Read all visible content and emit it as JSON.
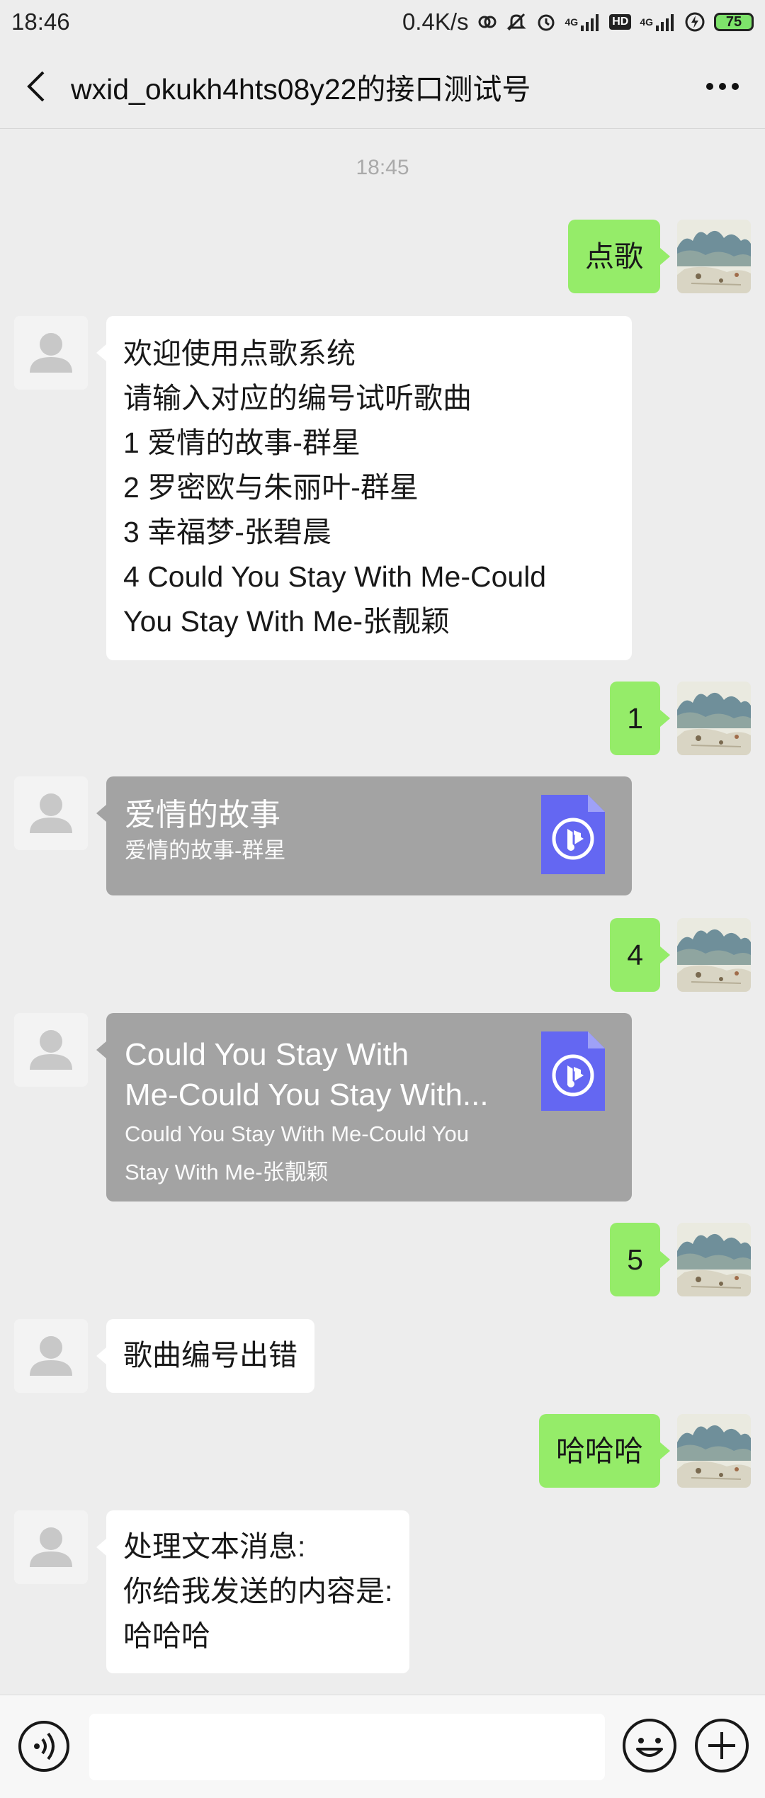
{
  "status_bar": {
    "time": "18:46",
    "speed": "0.4K/s",
    "network1": "4G",
    "hd": "HD",
    "network2": "4G",
    "battery": "75"
  },
  "header": {
    "title": "wxid_okukh4hts08y22的接口测试号"
  },
  "timestamp": "18:45",
  "messages": {
    "m1": {
      "text": "点歌"
    },
    "m2": {
      "lines": [
        "欢迎使用点歌系统",
        "请输入对应的编号试听歌曲",
        "1 爱情的故事-群星",
        "2 罗密欧与朱丽叶-群星",
        "3 幸福梦-张碧晨",
        "4 Could You Stay With Me-Could",
        "You Stay With Me-张靓颖"
      ]
    },
    "m3": {
      "text": "1"
    },
    "m4": {
      "title": "爱情的故事",
      "subtitle": "爱情的故事-群星",
      "icon": "music-file-icon"
    },
    "m5": {
      "text": "4"
    },
    "m6": {
      "title_lines": [
        "Could You Stay With",
        "Me-Could You Stay With..."
      ],
      "sub_lines": [
        "Could You Stay With Me-Could You",
        "Stay With Me-张靓颖"
      ],
      "icon": "music-file-icon"
    },
    "m7": {
      "text": "5"
    },
    "m8": {
      "text": "歌曲编号出错"
    },
    "m9": {
      "text": "哈哈哈"
    },
    "m10": {
      "lines": [
        "处理文本消息:",
        "你给我发送的内容是:",
        "哈哈哈"
      ]
    }
  },
  "input_bar": {
    "voice_icon": "voice-icon",
    "input_value": "",
    "emoji_icon": "emoji-icon",
    "plus_icon": "plus-icon"
  },
  "colors": {
    "background": "#ededed",
    "bubble_me": "#95ec69",
    "bubble_other": "#ffffff",
    "card": "#a3a3a3",
    "music_icon": "#6467f2"
  }
}
